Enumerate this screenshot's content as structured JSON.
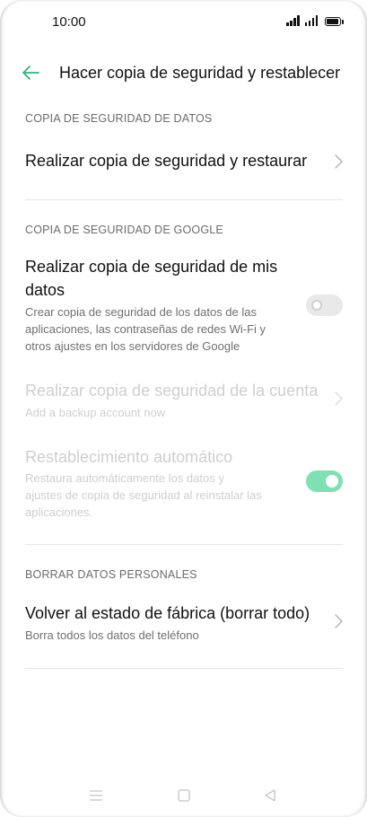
{
  "status_bar": {
    "time": "10:00"
  },
  "header": {
    "title": "Hacer copia de seguridad y restablecer"
  },
  "sections": {
    "data_backup": {
      "header": "COPIA DE SEGURIDAD DE DATOS",
      "backup_restore": {
        "title": "Realizar copia de seguridad y restaurar"
      }
    },
    "google_backup": {
      "header": "COPIA DE SEGURIDAD DE GOOGLE",
      "backup_my_data": {
        "title_line1": "Realizar copia de seguridad de mis",
        "title_line2": "datos",
        "desc_line1": "Crear copia de seguridad de los datos de las",
        "desc_line2": "aplicaciones, las contraseñas de redes Wi-Fi y",
        "desc_line3": "otros ajustes en los servidores de Google",
        "toggle_on": false
      },
      "backup_account": {
        "title": "Realizar copia de seguridad de la cuenta",
        "subtitle": "Add a backup account now",
        "enabled": false
      },
      "auto_restore": {
        "title": "Restablecimiento automático",
        "desc_line1": "Restaura automáticamente los datos y",
        "desc_line2": "ajustes de copia de seguridad al reinstalar las",
        "desc_line3": "aplicaciones.",
        "toggle_on": true,
        "enabled": false
      }
    },
    "personal_data": {
      "header": "BORRAR DATOS PERSONALES",
      "factory_reset": {
        "title": "Volver al estado de fábrica (borrar todo)",
        "subtitle": "Borra todos los datos del teléfono"
      }
    }
  },
  "colors": {
    "accent": "#33b27e",
    "toggle_on": "#7ee0b3",
    "disabled_text": "#cfcfcf"
  },
  "nav_bar": {
    "icons": [
      "menu-icon",
      "home-icon",
      "back-icon"
    ]
  }
}
